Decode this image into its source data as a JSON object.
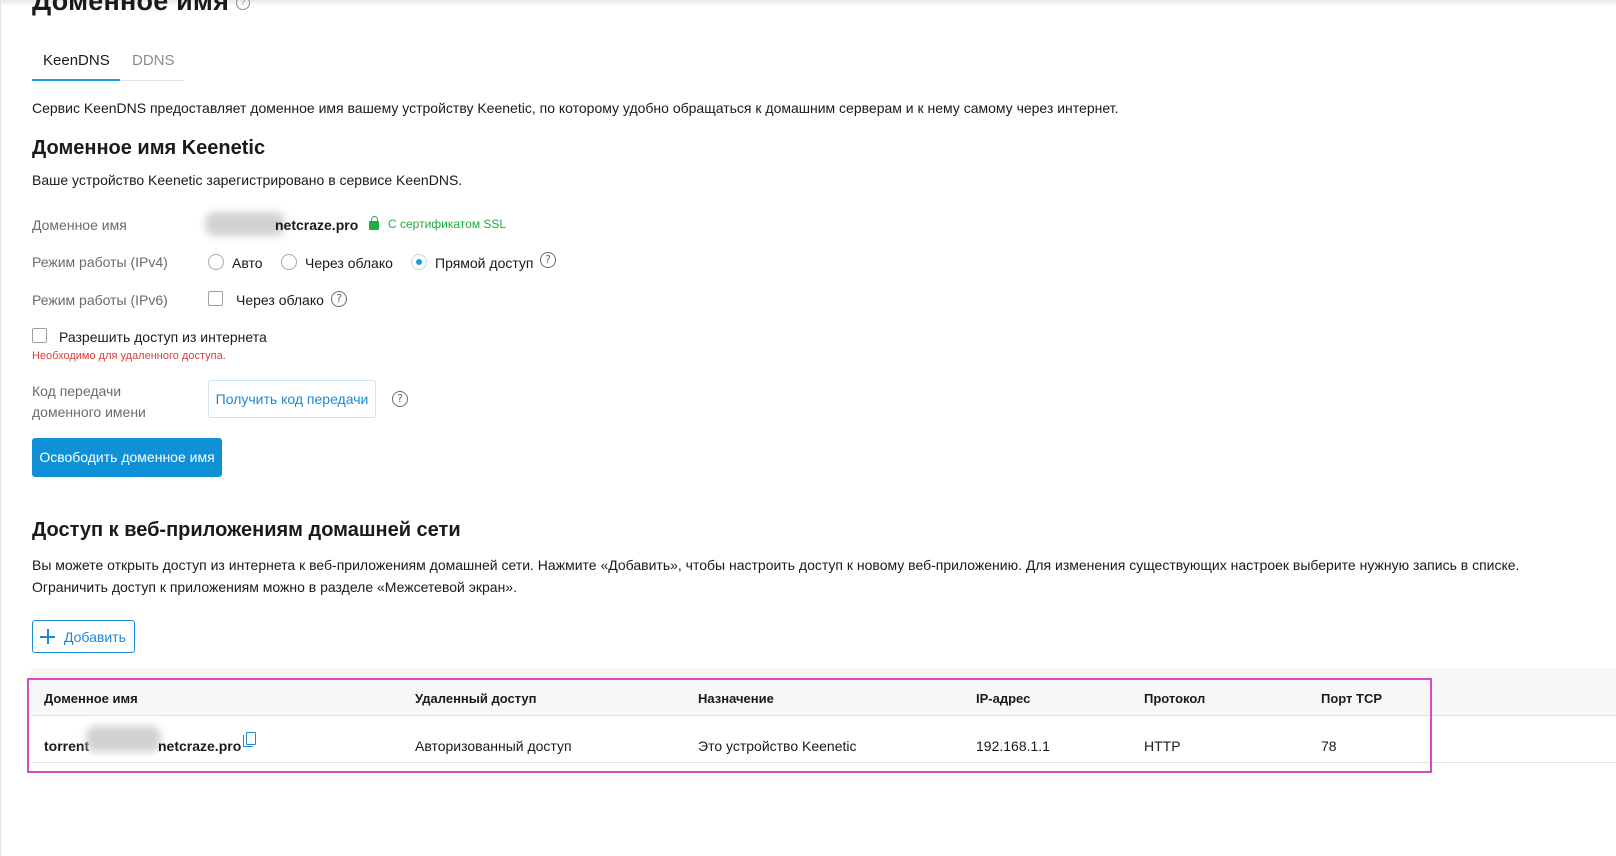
{
  "page": {
    "title": "Доменное имя",
    "help_glyph": "?"
  },
  "tabs": [
    {
      "label": "KeenDNS",
      "active": true
    },
    {
      "label": "DDNS",
      "active": false
    }
  ],
  "intro_text": "Сервис KeenDNS предоставляет доменное имя вашему устройству Keenetic, по которому удобно обращаться к домашним серверам и к нему самому через интернет.",
  "keenetic_section": {
    "heading": "Доменное имя Keenetic",
    "status_text": "Ваше устройство Keenetic зарегистрировано в сервисе KeenDNS.",
    "domain_label": "Доменное имя",
    "domain_value": "netcraze.pro",
    "ssl_text": "С сертификатом SSL",
    "ipv4_label": "Режим работы (IPv4)",
    "ipv4_options": [
      {
        "label": "Авто",
        "checked": false
      },
      {
        "label": "Через облако",
        "checked": false
      },
      {
        "label": "Прямой доступ",
        "checked": true
      }
    ],
    "ipv6_label": "Режим работы (IPv6)",
    "ipv6_option": {
      "label": "Через облако",
      "checked": false
    },
    "allow_internet_label": "Разрешить доступ из интернета",
    "allow_internet_checked": false,
    "warning_text": "Необходимо для удаленного доступа.",
    "transfer_label_line1": "Код передачи",
    "transfer_label_line2": "доменного имени",
    "transfer_button": "Получить код передачи",
    "release_button": "Освободить доменное имя"
  },
  "webapps_section": {
    "heading": "Доступ к веб-приложениям домашней сети",
    "desc_line1": "Вы можете открыть доступ из интернета к веб-приложениям домашней сети. Нажмите «Добавить», чтобы настроить доступ к новому веб-приложению. Для изменения существующих настроек выберите нужную запись в списке.",
    "desc_line2": "Ограничить доступ к приложениям можно в разделе «Межсетевой экран».",
    "add_button": "Добавить",
    "table": {
      "headers": [
        "Доменное имя",
        "Удаленный доступ",
        "Назначение",
        "IP-адрес",
        "Протокол",
        "Порт TCP"
      ],
      "rows": [
        {
          "domain_prefix": "torrent",
          "domain_suffix": "netcraze.pro",
          "remote_access": "Авторизованный доступ",
          "purpose": "Это устройство Keenetic",
          "ip": "192.168.1.1",
          "protocol": "HTTP",
          "port": "78"
        }
      ]
    }
  },
  "colors": {
    "accent": "#1a9ae0",
    "primary_button": "#0f91d8",
    "success": "#1fae3e",
    "error": "#e03c3c",
    "highlight": "#d54bc4"
  }
}
